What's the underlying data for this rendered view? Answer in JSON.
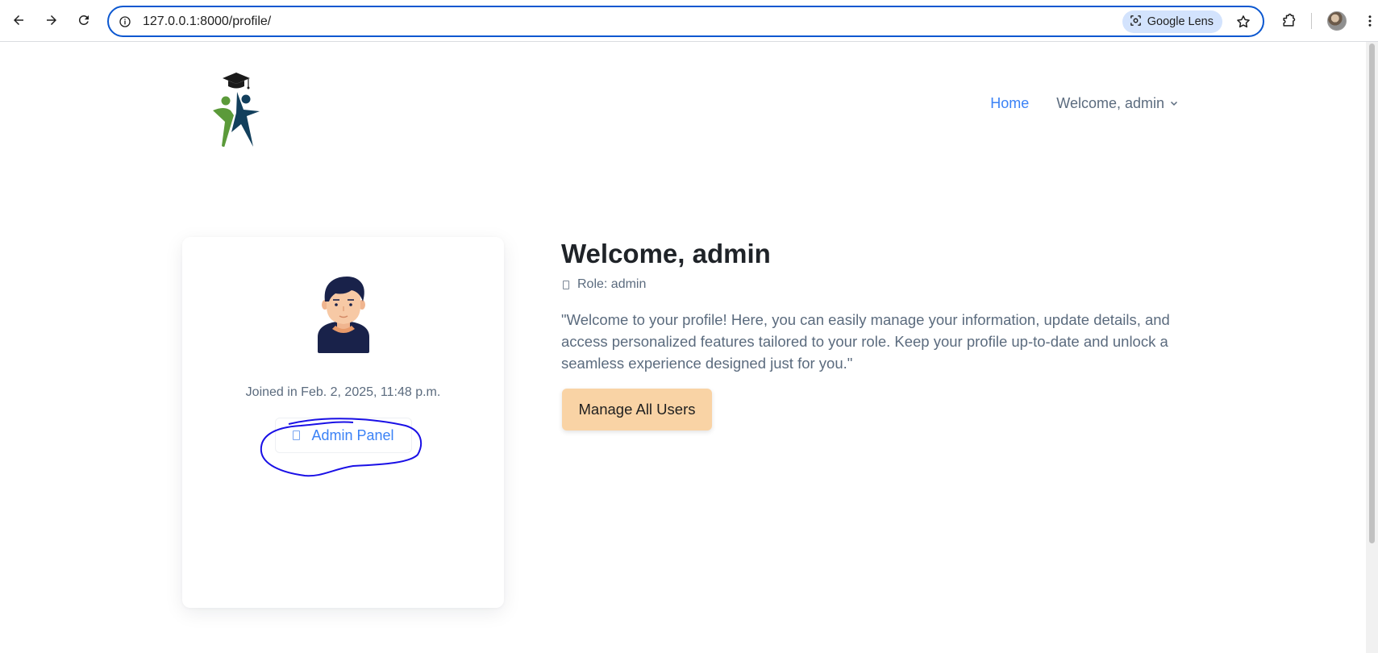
{
  "browser": {
    "url": "127.0.0.1:8000/profile/",
    "lens_label": "Google Lens"
  },
  "nav": {
    "home": "Home",
    "user_menu": "Welcome, admin"
  },
  "profile_card": {
    "joined": "Joined in Feb. 2, 2025, 11:48 p.m.",
    "admin_panel": "Admin Panel"
  },
  "main": {
    "title": "Welcome, admin",
    "role": "Role: admin",
    "intro": "\"Welcome to your profile! Here, you can easily manage your information, update details, and access personalized features tailored to your role. Keep your profile up-to-date and unlock a seamless experience designed just for you.\"",
    "manage_button": "Manage All Users"
  },
  "colors": {
    "accent_blue": "#3b82f6",
    "button_peach": "#f9d3a5",
    "annotation_ink": "#1a10e6",
    "omnibox_border": "#0b57d0"
  },
  "icons": {
    "back": "back-arrow-icon",
    "forward": "forward-arrow-icon",
    "reload": "reload-icon",
    "site_info": "site-info-icon",
    "lens": "google-lens-icon",
    "bookmark": "star-icon",
    "extensions": "puzzle-icon",
    "menu": "kebab-menu-icon",
    "dropdown": "chevron-down-icon"
  }
}
